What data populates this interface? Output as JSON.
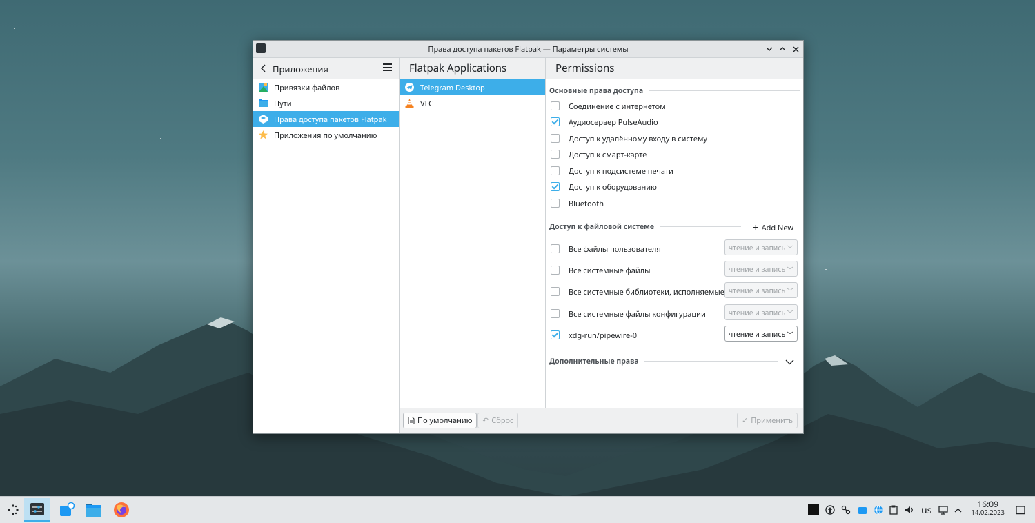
{
  "window": {
    "title": "Права доступа пакетов Flatpak — Параметры системы"
  },
  "sidebar": {
    "title": "Приложения",
    "items": [
      {
        "label": "Привязки файлов",
        "icon": "file-associations-icon"
      },
      {
        "label": "Пути",
        "icon": "folder-icon"
      },
      {
        "label": "Права доступа пакетов Flatpak",
        "icon": "flatpak-icon",
        "selected": true
      },
      {
        "label": "Приложения по умолчанию",
        "icon": "star-icon"
      }
    ]
  },
  "apps": {
    "title": "Flatpak Applications",
    "items": [
      {
        "label": "Telegram Desktop",
        "icon": "telegram-icon",
        "selected": true
      },
      {
        "label": "VLC",
        "icon": "vlc-icon"
      }
    ]
  },
  "permissions": {
    "title": "Permissions",
    "basic": {
      "title": "Основные права доступа",
      "items": [
        {
          "label": "Соединение с интернетом",
          "checked": false
        },
        {
          "label": "Аудиосервер PulseAudio",
          "checked": true
        },
        {
          "label": "Доступ к удалённому входу в систему",
          "checked": false
        },
        {
          "label": "Доступ к смарт-карте",
          "checked": false
        },
        {
          "label": "Доступ к подсистеме печати",
          "checked": false
        },
        {
          "label": "Доступ к оборудованию",
          "checked": true
        },
        {
          "label": "Bluetooth",
          "checked": false
        }
      ]
    },
    "filesystem": {
      "title": "Доступ к файловой системе",
      "add_new": "Add New",
      "items": [
        {
          "label": "Все файлы пользователя",
          "checked": false,
          "mode": "чтение и запись"
        },
        {
          "label": "Все системные файлы",
          "checked": false,
          "mode": "чтение и запись"
        },
        {
          "label": "Все системные библиотеки, исполняемые...",
          "checked": false,
          "mode": "чтение и запись"
        },
        {
          "label": "Все системные файлы конфигурации",
          "checked": false,
          "mode": "чтение и запись"
        },
        {
          "label": "xdg-run/pipewire-0",
          "checked": true,
          "mode": "чтение и запись"
        }
      ]
    },
    "advanced": {
      "title": "Дополнительные права"
    }
  },
  "footer": {
    "defaults": "По умолчанию",
    "reset": "Сброс",
    "apply": "Применить"
  },
  "taskbar": {
    "keyboard_layout": "us",
    "time": "16:09",
    "date": "14.02.2023"
  },
  "colors": {
    "accent": "#3daee9",
    "window_bg": "#eff0f1"
  }
}
